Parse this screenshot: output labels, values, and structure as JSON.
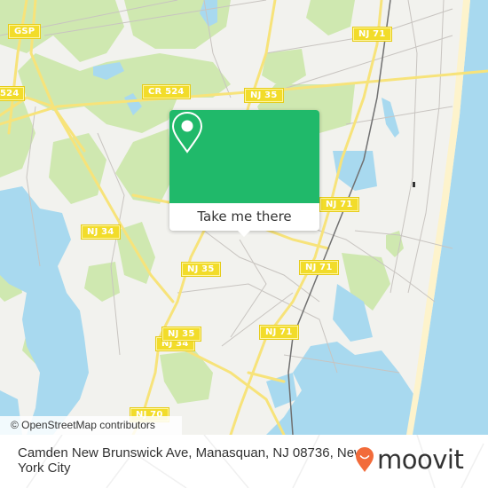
{
  "map": {
    "road_labels": [
      {
        "id": "gsp",
        "text": "GSP"
      },
      {
        "id": "cr524-left",
        "text": "524"
      },
      {
        "id": "cr524",
        "text": "CR 524"
      },
      {
        "id": "nj35-top",
        "text": "NJ 35"
      },
      {
        "id": "nj71-top",
        "text": "NJ 71"
      },
      {
        "id": "nj34-upper",
        "text": "NJ 34"
      },
      {
        "id": "nj34-lower",
        "text": "NJ 34"
      },
      {
        "id": "nj71-mid",
        "text": "NJ 71"
      },
      {
        "id": "nj35-mid",
        "text": "NJ 35"
      },
      {
        "id": "nj71-center",
        "text": "NJ 71"
      },
      {
        "id": "nj35-lower",
        "text": "NJ 35"
      },
      {
        "id": "nj71-lower",
        "text": "NJ 71"
      },
      {
        "id": "nj70",
        "text": "NJ 70"
      }
    ],
    "colors": {
      "land": "#f2f2ee",
      "park": "#cfe8b0",
      "water": "#a8d9ef",
      "beach": "#fdf3cc",
      "highway": "#f7e37a",
      "minor_road": "#c8c4c0",
      "rail": "#707070"
    },
    "attribution": "© OpenStreetMap contributors"
  },
  "popup": {
    "action_label": "Take me there",
    "icon": "map-pin-icon",
    "color": "#20b96a"
  },
  "footer": {
    "address": "Camden New Brunswick Ave, Manasquan, NJ 08736, New York City",
    "brand": "moovit",
    "brand_color": "#f26b3a"
  }
}
